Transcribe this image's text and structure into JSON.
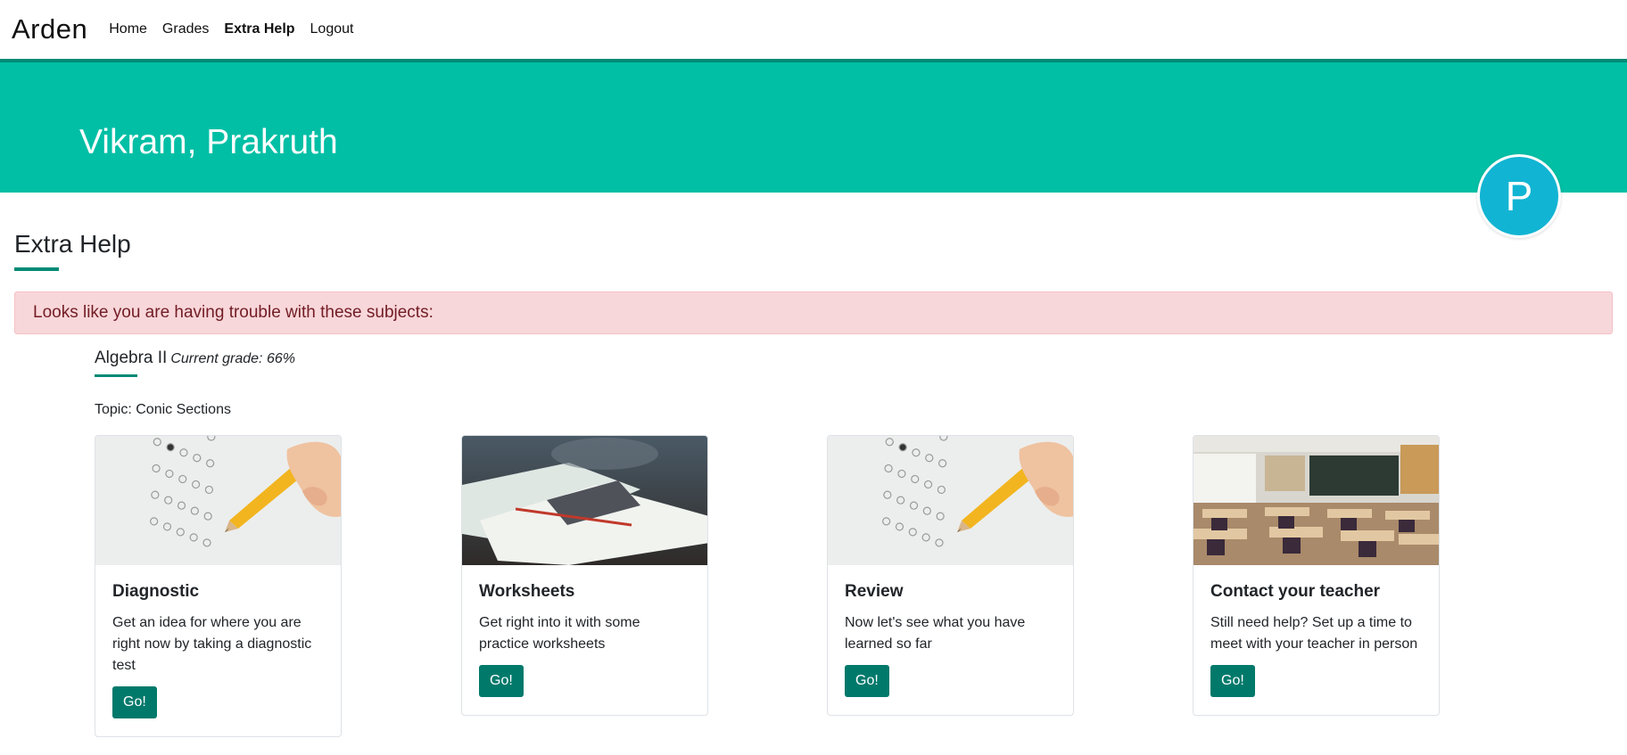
{
  "navbar": {
    "brand": "Arden",
    "links": [
      {
        "label": "Home",
        "active": false
      },
      {
        "label": "Grades",
        "active": false
      },
      {
        "label": "Extra Help",
        "active": true
      },
      {
        "label": "Logout",
        "active": false
      }
    ]
  },
  "hero": {
    "name": "Vikram, Prakruth",
    "avatar_letter": "P"
  },
  "section": {
    "title": "Extra Help"
  },
  "alert": {
    "text": "Looks like you are having trouble with these subjects:"
  },
  "subject": {
    "name": "Algebra II",
    "grade": "Current grade: 66%",
    "topic": "Topic: Conic Sections"
  },
  "cards": [
    {
      "title": "Diagnostic",
      "text": "Get an idea for where you are right now by taking a diagnostic test",
      "button": "Go!",
      "image": "test-sheet-pencil-photo"
    },
    {
      "title": "Worksheets",
      "text": "Get right into it with some practice worksheets",
      "button": "Go!",
      "image": "papers-on-desk-photo"
    },
    {
      "title": "Review",
      "text": "Now let's see what you have learned so far",
      "button": "Go!",
      "image": "test-sheet-pencil-photo"
    },
    {
      "title": "Contact your teacher",
      "text": "Still need help? Set up a time to meet with your teacher in person",
      "button": "Go!",
      "image": "classroom-photo"
    }
  ],
  "colors": {
    "accent": "#00bfa5",
    "accent_dark": "#008a75",
    "button": "#00796b",
    "avatar": "#12b4d3",
    "alert_bg": "#f8d7da",
    "alert_text": "#721c24"
  }
}
